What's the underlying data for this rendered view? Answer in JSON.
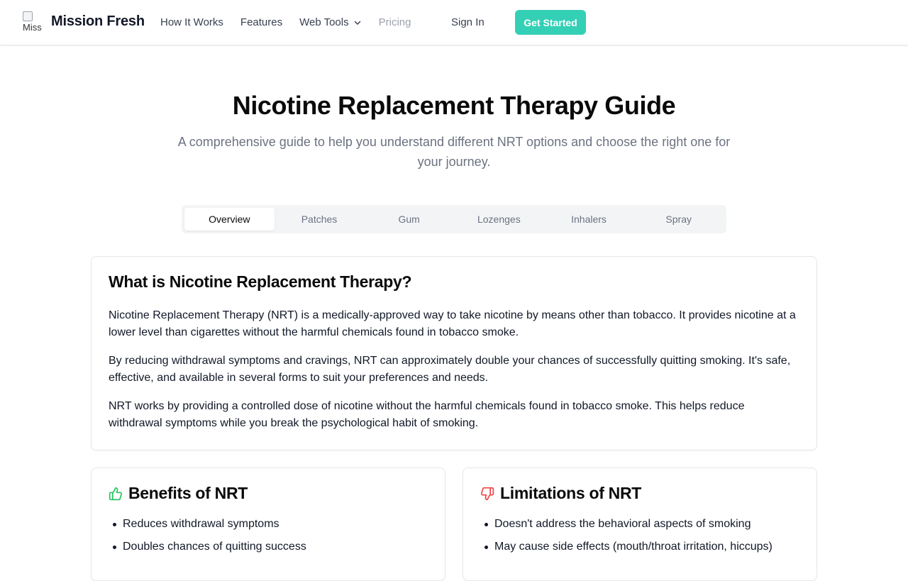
{
  "header": {
    "logo_alt": "Miss",
    "brand": "Mission Fresh",
    "nav": [
      {
        "label": "How It Works"
      },
      {
        "label": "Features"
      },
      {
        "label": "Web Tools"
      },
      {
        "label": "Pricing"
      }
    ],
    "sign_in": "Sign In",
    "cta": "Get Started",
    "accent_color": "#34d0b6"
  },
  "hero": {
    "title": "Nicotine Replacement Therapy Guide",
    "subtitle": "A comprehensive guide to help you understand different NRT options and choose the right one for your journey."
  },
  "tabs": [
    {
      "label": "Overview",
      "active": true
    },
    {
      "label": "Patches"
    },
    {
      "label": "Gum"
    },
    {
      "label": "Lozenges"
    },
    {
      "label": "Inhalers"
    },
    {
      "label": "Spray"
    }
  ],
  "overview": {
    "heading": "What is Nicotine Replacement Therapy?",
    "paragraphs": [
      "Nicotine Replacement Therapy (NRT) is a medically-approved way to take nicotine by means other than tobacco. It provides nicotine at a lower level than cigarettes without the harmful chemicals found in tobacco smoke.",
      "By reducing withdrawal symptoms and cravings, NRT can approximately double your chances of successfully quitting smoking. It's safe, effective, and available in several forms to suit your preferences and needs.",
      "NRT works by providing a controlled dose of nicotine without the harmful chemicals found in tobacco smoke. This helps reduce withdrawal symptoms while you break the psychological habit of smoking."
    ]
  },
  "benefits": {
    "heading": "Benefits of NRT",
    "icon": "thumbs-up-icon",
    "icon_color": "#22c55e",
    "items": [
      "Reduces withdrawal symptoms",
      "Doubles chances of quitting success"
    ]
  },
  "limitations": {
    "heading": "Limitations of NRT",
    "icon": "thumbs-down-icon",
    "icon_color": "#ef4444",
    "items": [
      "Doesn't address the behavioral aspects of smoking",
      "May cause side effects (mouth/throat irritation, hiccups)"
    ]
  }
}
